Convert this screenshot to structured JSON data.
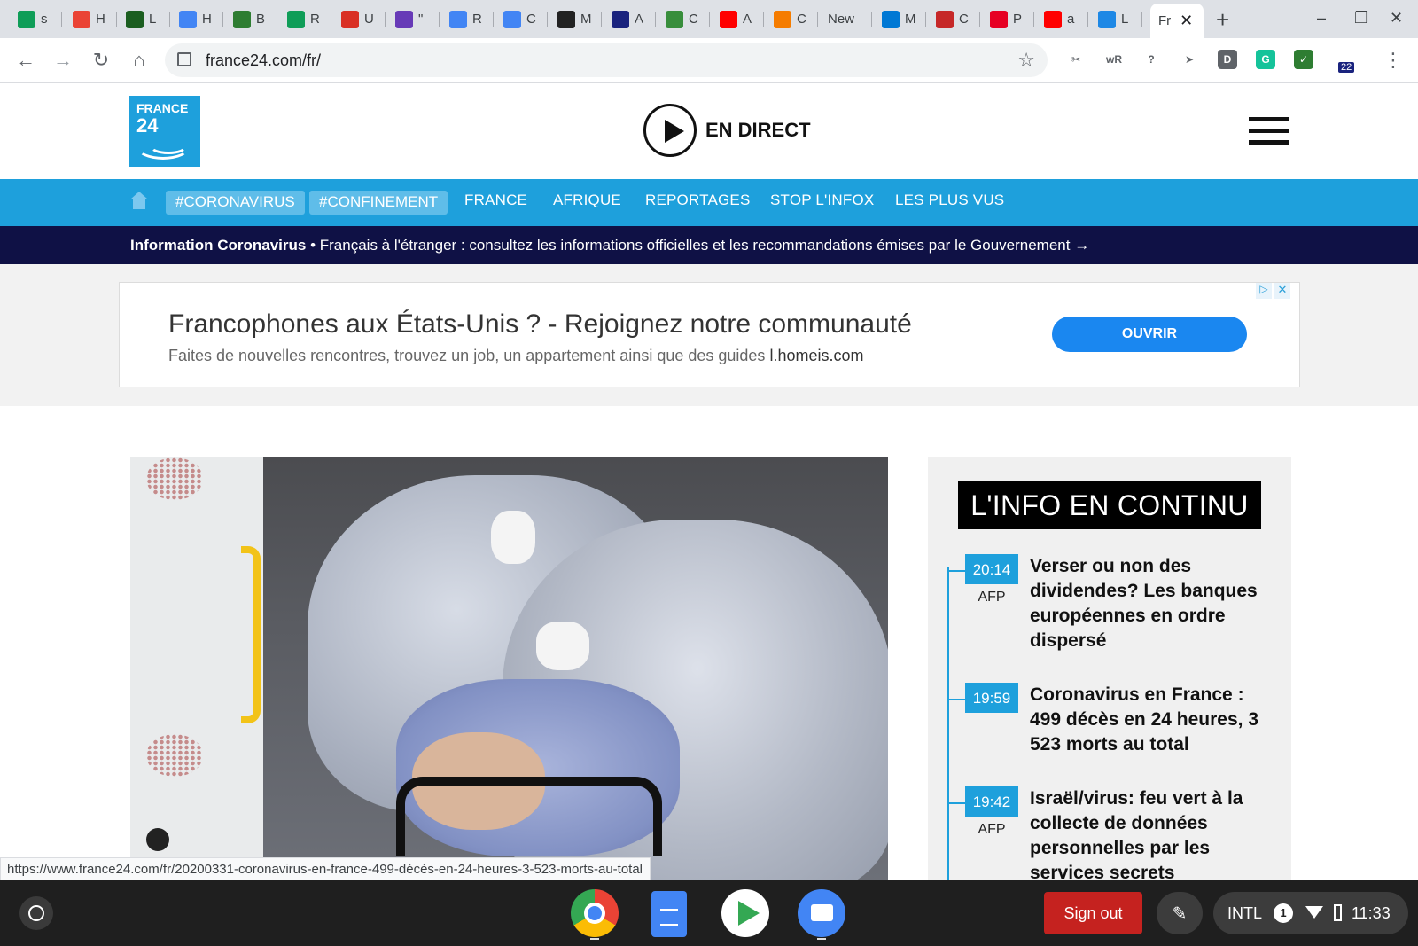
{
  "browser": {
    "tabs": [
      {
        "label": "s",
        "icon": "google-drive-icon",
        "color": "#0f9d58"
      },
      {
        "label": "H",
        "icon": "gmail-icon",
        "color": "#ea4335"
      },
      {
        "label": "L",
        "icon": "vuses-icon",
        "color": "#1b5e20"
      },
      {
        "label": "H",
        "icon": "docs-icon",
        "color": "#4285f4"
      },
      {
        "label": "B",
        "icon": "tree-icon",
        "color": "#2e7d32"
      },
      {
        "label": "R",
        "icon": "google-drive-icon",
        "color": "#0f9d58"
      },
      {
        "label": "U",
        "icon": "app-icon",
        "color": "#d93025"
      },
      {
        "label": "\"",
        "icon": "forms-icon",
        "color": "#673ab7"
      },
      {
        "label": "R",
        "icon": "chat-icon",
        "color": "#4285f4"
      },
      {
        "label": "C",
        "icon": "contacts-icon",
        "color": "#4285f4"
      },
      {
        "label": "M",
        "icon": "mesh-icon",
        "color": "#222222"
      },
      {
        "label": "A",
        "icon": "a-icon",
        "color": "#1a237e"
      },
      {
        "label": "C",
        "icon": "flag-icon",
        "color": "#388e3c"
      },
      {
        "label": "A",
        "icon": "youtube-icon",
        "color": "#ff0000"
      },
      {
        "label": "C",
        "icon": "rainbow-icon",
        "color": "#f57c00"
      },
      {
        "label": "New",
        "icon": "",
        "color": "#dee1e6"
      },
      {
        "label": "M",
        "icon": "outlook-icon",
        "color": "#0078d4"
      },
      {
        "label": "C",
        "icon": "shield-icon",
        "color": "#c62828"
      },
      {
        "label": "P",
        "icon": "pinterest-icon",
        "color": "#e60023"
      },
      {
        "label": "a",
        "icon": "youtube-icon",
        "color": "#ff0000"
      },
      {
        "label": "L",
        "icon": "h-icon",
        "color": "#1e88e5"
      }
    ],
    "active_tab": {
      "label": "Fr",
      "close": "✕"
    },
    "new_tab": "+",
    "window_controls": {
      "minimize": "–",
      "restore": "❐",
      "close": "✕"
    },
    "url": "france24.com/fr/",
    "star": "☆",
    "extensions": [
      {
        "icon": "scissors-icon",
        "text": "✂",
        "color": "#ffffff"
      },
      {
        "icon": "wordreference-icon",
        "text": "wR",
        "color": "#ffffff"
      },
      {
        "icon": "help-icon",
        "text": "?",
        "color": "#ffffff"
      },
      {
        "icon": "arrow-icon",
        "text": "➤",
        "color": "#ffffff"
      },
      {
        "icon": "d-icon",
        "text": "D",
        "color": "#5f6368"
      },
      {
        "icon": "grammarly-icon",
        "text": "G",
        "color": "#15c39a"
      },
      {
        "icon": "green-check-icon",
        "text": "✓",
        "color": "#2e7d32"
      },
      {
        "icon": "ext-badge-icon",
        "text": "",
        "color": "#ffffff"
      }
    ],
    "ext_badge": "22",
    "menu": "⋮"
  },
  "site": {
    "logo_line1": "FRANCE",
    "logo_line2": "24",
    "live_label": "EN DIRECT",
    "nav": {
      "pills": [
        "#CORONAVIRUS",
        "#CONFINEMENT"
      ],
      "items": [
        "FRANCE",
        "AFRIQUE",
        "REPORTAGES",
        "STOP L'INFOX",
        "LES PLUS VUS"
      ]
    },
    "info_bar": {
      "bold": "Information Coronavirus",
      "text": " • Français à l'étranger : consultez les informations officielles et les recommandations émises par le Gouvernement →"
    }
  },
  "ad": {
    "title": "Francophones aux États-Unis ? - Rejoignez notre communauté",
    "subtitle": "Faites de nouvelles rencontres, trouvez un job, un appartement ainsi que des guides",
    "domain": "l.homeis.com",
    "button": "OUVRIR",
    "choice": "▷",
    "close": "✕"
  },
  "sidebar": {
    "title": "L'INFO EN CONTINU",
    "items": [
      {
        "time": "20:14",
        "source": "AFP",
        "headline": "Verser ou non des dividendes? Les banques européennes en ordre dispersé"
      },
      {
        "time": "19:59",
        "source": "",
        "headline": "Coronavirus en France : 499 décès en 24 heures, 3 523 morts au total"
      },
      {
        "time": "19:42",
        "source": "AFP",
        "headline": "Israël/virus: feu vert à la collecte de données personnelles par les services secrets"
      }
    ]
  },
  "status_url": "https://www.france24.com/fr/20200331-coronavirus-en-france-499-décès-en-24-heures-3-523-morts-au-total",
  "shelf": {
    "sign_out": "Sign out",
    "pen": "✎",
    "locale": "INTL",
    "notifications": "1",
    "clock": "11:33"
  }
}
